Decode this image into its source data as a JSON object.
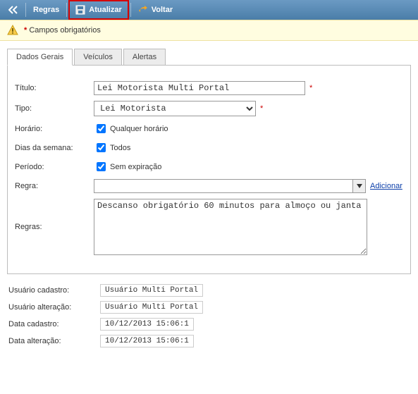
{
  "toolbar": {
    "regras": "Regras",
    "atualizar": "Atualizar",
    "voltar": "Voltar"
  },
  "required_notice": "Campos obrigatórios",
  "tabs": {
    "dados_gerais": "Dados Gerais",
    "veiculos": "Veículos",
    "alertas": "Alertas"
  },
  "form": {
    "titulo_label": "Título:",
    "titulo_value": "Lei Motorista Multi Portal",
    "tipo_label": "Tipo:",
    "tipo_value": "Lei Motorista",
    "horario_label": "Horário:",
    "horario_checkbox": "Qualquer horário",
    "dias_label": "Dias da semana:",
    "dias_checkbox": "Todos",
    "periodo_label": "Período:",
    "periodo_checkbox": "Sem expiração",
    "regra_label": "Regra:",
    "regra_value": "",
    "adicionar": "Adicionar",
    "regras_label": "Regras:",
    "regras_value": "Descanso obrigatório 60 minutos para almoço ou janta"
  },
  "meta": {
    "usuario_cadastro_label": "Usuário cadastro:",
    "usuario_cadastro_value": "Usuário Multi Portal",
    "usuario_alteracao_label": "Usuário alteração:",
    "usuario_alteracao_value": "Usuário Multi Portal",
    "data_cadastro_label": "Data cadastro:",
    "data_cadastro_value": "10/12/2013 15:06:1",
    "data_alteracao_label": "Data alteração:",
    "data_alteracao_value": "10/12/2013 15:06:1"
  }
}
